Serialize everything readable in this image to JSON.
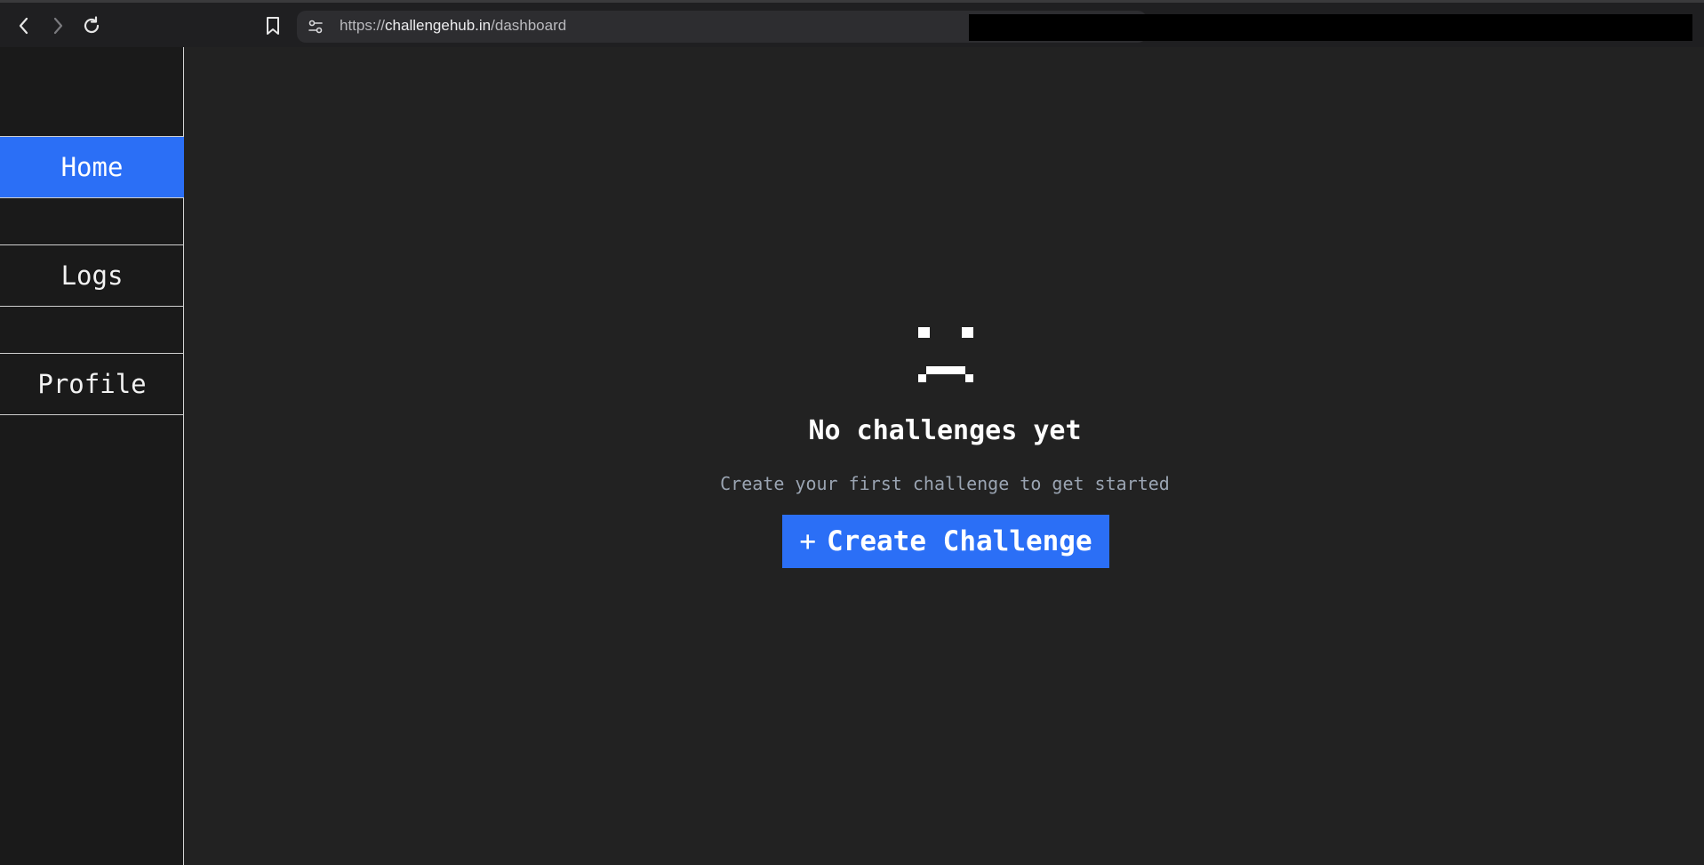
{
  "browser": {
    "url_scheme": "https://",
    "url_host": "challengehub.in",
    "url_path": "/dashboard",
    "icons": [
      "back-icon",
      "forward-icon",
      "reload-icon",
      "bookmark-icon",
      "site-settings-icon"
    ]
  },
  "sidebar": {
    "items": [
      {
        "label": "Home",
        "active": true
      },
      {
        "label": "Logs",
        "active": false
      },
      {
        "label": "Profile",
        "active": false
      }
    ]
  },
  "empty_state": {
    "icon": "sad-face-icon",
    "title": "No challenges yet",
    "subtitle": "Create your first challenge to get started",
    "button_icon": "+",
    "button_label": "Create Challenge"
  },
  "colors": {
    "accent": "#2b6ff6",
    "background": "#222222",
    "sidebar": "#1a1a1a",
    "subtitle": "#9aa4b2"
  }
}
